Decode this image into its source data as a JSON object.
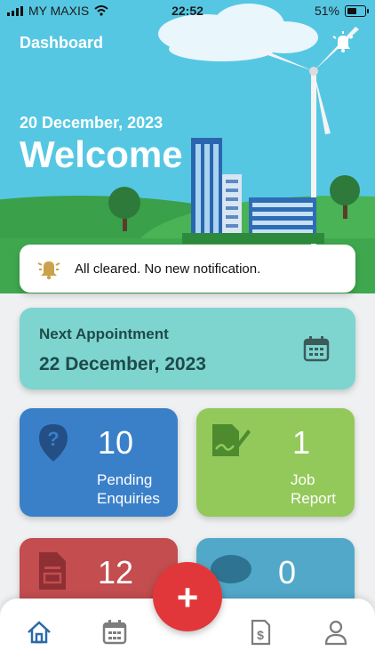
{
  "status_bar": {
    "carrier": "MY MAXIS",
    "time": "22:52",
    "battery": "51%"
  },
  "header": {
    "title": "Dashboard",
    "date": "20 December, 2023",
    "greeting": "Welcome"
  },
  "notification": {
    "text": "All cleared. No new notification."
  },
  "appointment": {
    "label": "Next Appointment",
    "date": "22 December, 2023"
  },
  "tiles": [
    {
      "count": "10",
      "label_line1": "Pending",
      "label_line2": "Enquiries",
      "color": "#3a80c9"
    },
    {
      "count": "1",
      "label_line1": "Job",
      "label_line2": "Report",
      "color": "#93c95a"
    },
    {
      "count": "12",
      "label_line1": "",
      "label_line2": "",
      "color": "#c34d4f"
    },
    {
      "count": "0",
      "label_line1": "",
      "label_line2": "",
      "color": "#52a8c9"
    }
  ],
  "tab_bar": {
    "items": [
      "home-icon",
      "calendar-icon",
      "add-icon",
      "invoice-icon",
      "profile-icon"
    ],
    "active": "home-icon"
  },
  "colors": {
    "sky": "#56c7e3",
    "accent_red": "#e2373a",
    "tab_active": "#2a6aa8",
    "tab_inactive": "#7d7d7d"
  }
}
